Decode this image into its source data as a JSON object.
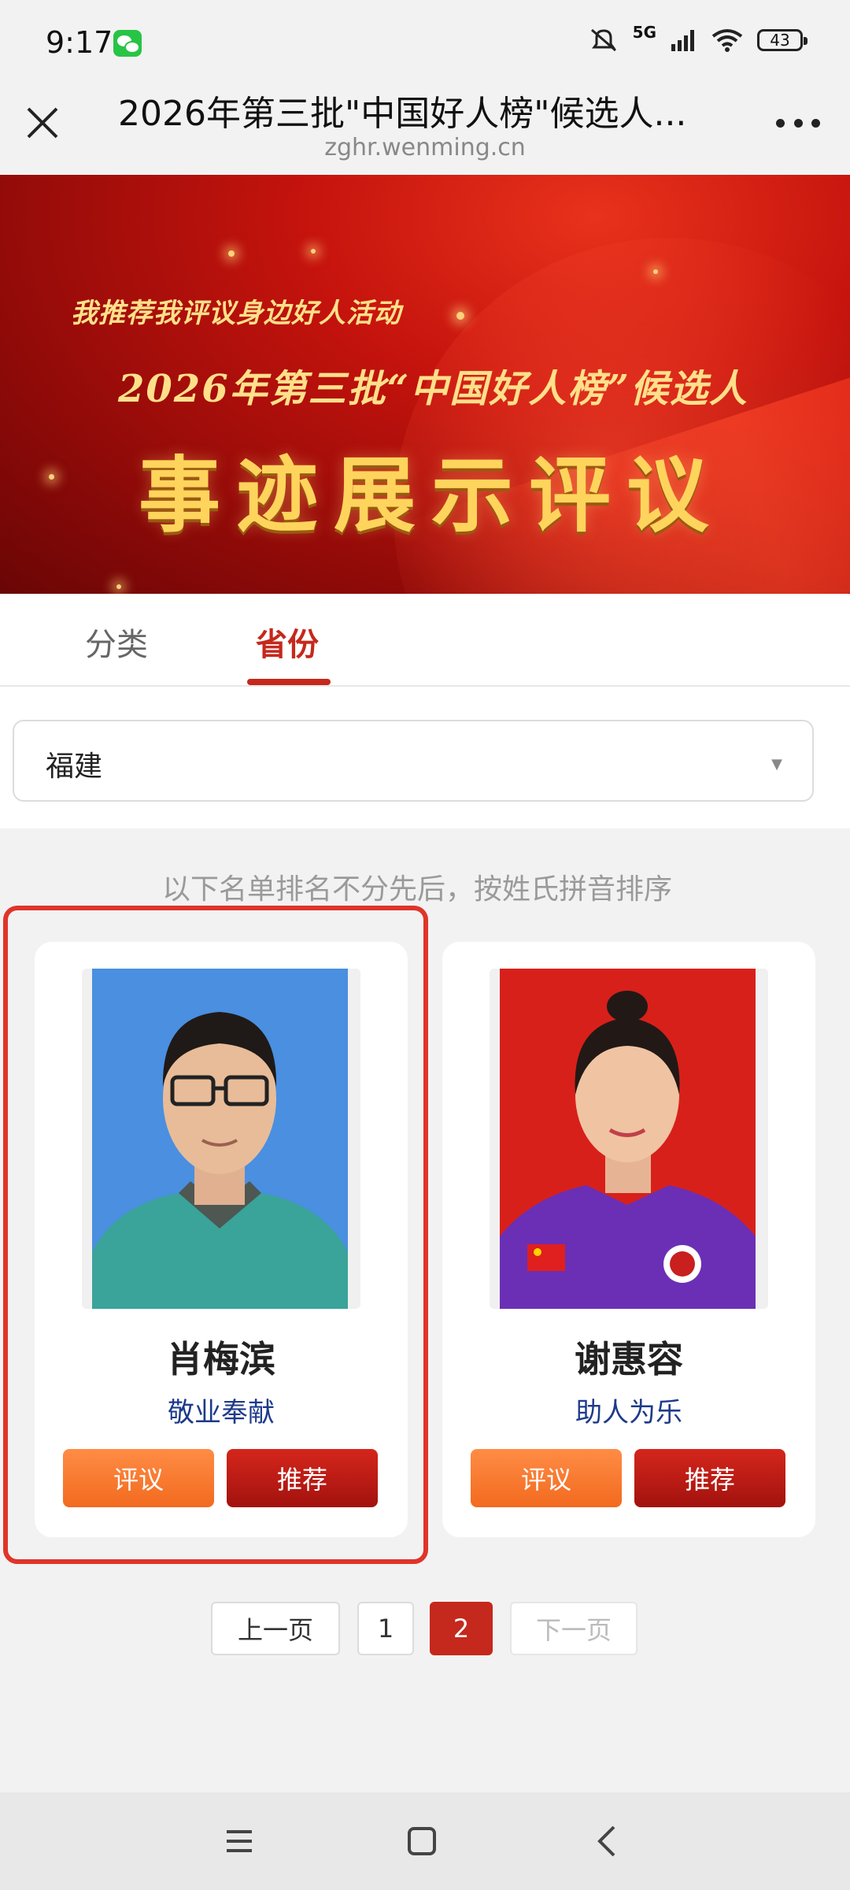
{
  "status_bar": {
    "time": "9:17",
    "network": "5G",
    "battery": "43"
  },
  "title_bar": {
    "title": "2026年第三批\"中国好人榜\"候选人...",
    "url": "zghr.wenming.cn"
  },
  "banner": {
    "line1": "我推荐我评议身边好人活动",
    "line2": "2026年第三批“中国好人榜”候选人",
    "line3": "事迹展示评议"
  },
  "tabs": [
    {
      "label": "分类",
      "active": false
    },
    {
      "label": "省份",
      "active": true
    }
  ],
  "province_select": {
    "value": "福建"
  },
  "note": "以下名单排名不分先后，按姓氏拼音排序",
  "candidates": [
    {
      "name": "肖梅滨",
      "category": "敬业奉献",
      "comment_label": "评议",
      "recommend_label": "推荐",
      "photo_bg": "#4a8fe0",
      "highlighted": true
    },
    {
      "name": "谢惠容",
      "category": "助人为乐",
      "comment_label": "评议",
      "recommend_label": "推荐",
      "photo_bg": "#d8201a",
      "highlighted": false
    }
  ],
  "pagination": {
    "prev": "上一页",
    "pages": [
      "1",
      "2"
    ],
    "current": "2",
    "next": "下一页"
  },
  "colors": {
    "accent": "#c5281c",
    "comment_button": "#f47a30",
    "recommend_button": "#b8190f",
    "category_text": "#1e3a8a"
  }
}
